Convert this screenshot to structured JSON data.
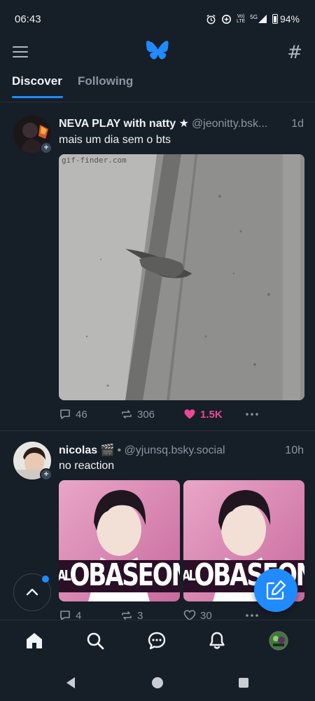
{
  "status_bar": {
    "time": "06:43",
    "volte": "Vo)",
    "lte": "LTE",
    "network": "5G",
    "battery": "94%"
  },
  "header": {
    "icons": {
      "menu": "menu-icon",
      "logo": "bluesky-butterfly-logo",
      "feeds": "hashtag-icon"
    }
  },
  "tabs": [
    {
      "label": "Discover",
      "active": true
    },
    {
      "label": "Following",
      "active": false
    }
  ],
  "posts": [
    {
      "author": "NEVA PLAY with natty ★",
      "handle": "@jeonitty.bsk...",
      "time": "1d",
      "text": "mais um dia sem o bts",
      "media_watermark": "gif-finder.com",
      "stats": {
        "replies": "46",
        "reposts": "306",
        "likes": "1.5K"
      },
      "liked": true
    },
    {
      "author": "nicolas 🎬",
      "handle": "• @yjunsq.bsky.social",
      "time": "10h",
      "text": "no reaction",
      "media_caption": "OBASEONE",
      "media_prefix": "AL",
      "stats": {
        "replies": "4",
        "reposts": "3",
        "likes": "30"
      },
      "liked": false
    }
  ],
  "bottom_nav": [
    "home-icon",
    "search-icon",
    "chat-icon",
    "notifications-icon",
    "profile-avatar"
  ],
  "colors": {
    "background": "#161e27",
    "accent": "#208bfe",
    "like": "#ec4899",
    "muted": "#8a96a3"
  }
}
